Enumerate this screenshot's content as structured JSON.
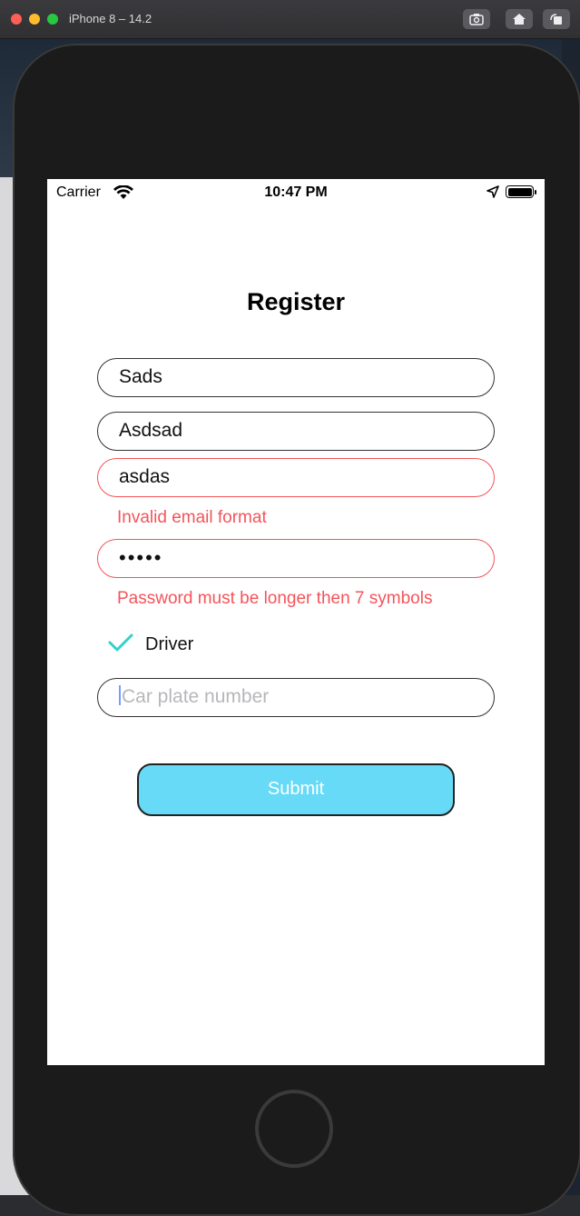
{
  "simulator": {
    "title": "iPhone 8 – 14.2",
    "buttons": [
      "screenshot-icon",
      "home-icon",
      "rotate-icon"
    ]
  },
  "status_bar": {
    "carrier": "Carrier",
    "time": "10:47 PM"
  },
  "form": {
    "title": "Register",
    "first_name_value": "Sads",
    "last_name_value": "Asdsad",
    "email_value": "asdas",
    "email_error": "Invalid email format",
    "password_value": "•••••",
    "password_error": "Password must be longer then 7 symbols",
    "driver_label": "Driver",
    "driver_checked": true,
    "car_plate_placeholder": "Car plate number",
    "submit_label": "Submit"
  },
  "colors": {
    "error": "#f3545a",
    "accent_check": "#2fd3c9",
    "submit_bg": "#66daf6"
  }
}
